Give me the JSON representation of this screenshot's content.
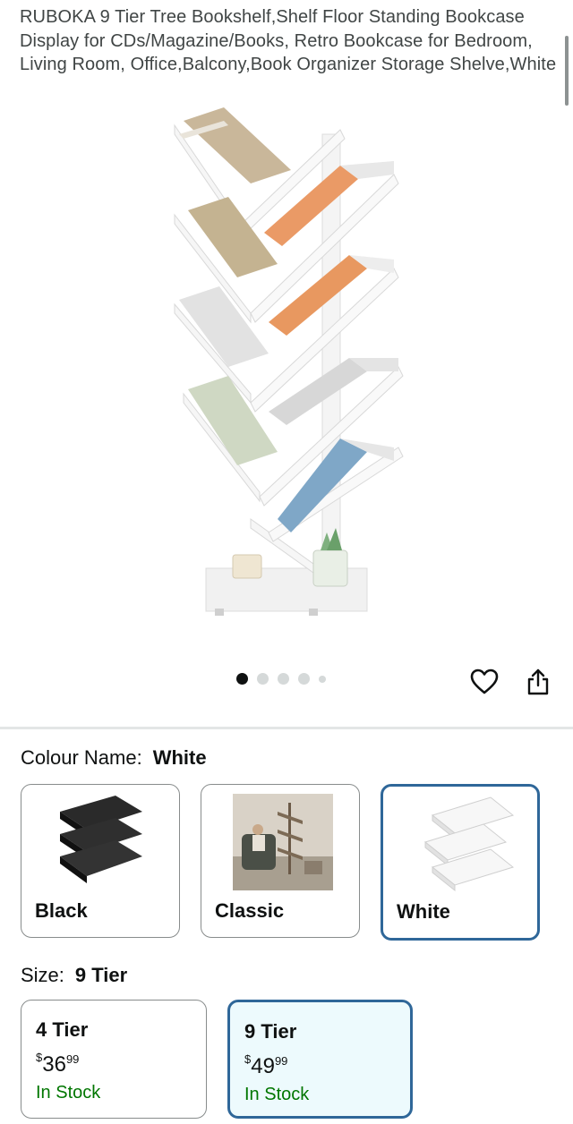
{
  "product": {
    "title": "RUBOKA 9 Tier Tree Bookshelf,Shelf Floor Standing Bookcase Display for CDs/Magazine/Books, Retro Bookcase for Bedroom, Living Room, Office,Balcony,Book Organizer Storage Shelve,White"
  },
  "gallery": {
    "dots": 5,
    "active_index": 0
  },
  "colour": {
    "label": "Colour Name:",
    "selected": "White",
    "options": [
      {
        "label": "Black"
      },
      {
        "label": "Classic"
      },
      {
        "label": "White"
      }
    ]
  },
  "size": {
    "label": "Size:",
    "selected": "9 Tier",
    "options": [
      {
        "name": "4 Tier",
        "currency": "$",
        "whole": "36",
        "fraction": "99",
        "stock": "In Stock"
      },
      {
        "name": "9 Tier",
        "currency": "$",
        "whole": "49",
        "fraction": "99",
        "stock": "In Stock"
      }
    ]
  },
  "colors": {
    "accent_border": "#2f6799",
    "in_stock": "#007600",
    "selected_bg": "#edfafd"
  },
  "icons": [
    "heart-icon",
    "share-icon"
  ]
}
